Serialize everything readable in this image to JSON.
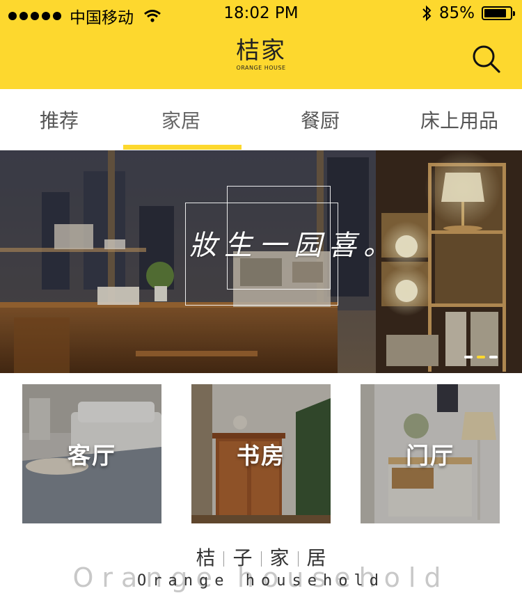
{
  "status_bar": {
    "carrier": "中国移动",
    "time": "18:02 PM",
    "battery": "85%",
    "battery_level": 0.85
  },
  "header": {
    "logo_zh": "桔家",
    "logo_en": "ORANGE HOUSE",
    "search_icon": "search-icon",
    "background": "#fdd82e"
  },
  "tabs": [
    {
      "label": "推荐"
    },
    {
      "label": "家居",
      "active": true
    },
    {
      "label": "餐厨"
    },
    {
      "label": "床上用品"
    }
  ],
  "banner": {
    "slogan": "妝生一园喜。",
    "pager_total": 3,
    "pager_active": 2
  },
  "categories": [
    {
      "label": "客厅"
    },
    {
      "label": "书房"
    },
    {
      "label": "门厅"
    }
  ],
  "brand": {
    "name_zh": [
      "桔",
      "子",
      "家",
      "居"
    ],
    "watermark_en": "Orange household",
    "name_en": "Orange household"
  },
  "colors": {
    "accent": "#fdd82e"
  }
}
